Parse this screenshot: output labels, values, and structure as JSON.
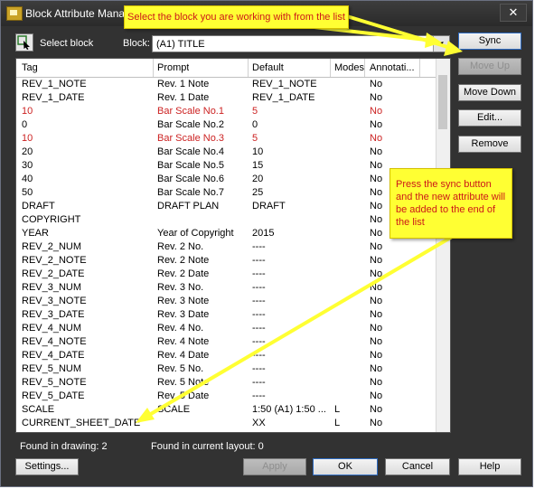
{
  "window": {
    "title": "Block Attribute Manag",
    "close_glyph": "✕"
  },
  "toolbar": {
    "select_block_label": "Select block",
    "block_label": "Block:",
    "block_value": "(A1) TITLE"
  },
  "grid": {
    "headers": [
      "Tag",
      "Prompt",
      "Default",
      "Modes",
      "Annotati..."
    ],
    "rows": [
      {
        "tag": "REV_1_NOTE",
        "prompt": "Rev. 1 Note",
        "default": "REV_1_NOTE",
        "modes": "",
        "annot": "No",
        "red": false
      },
      {
        "tag": "REV_1_DATE",
        "prompt": "Rev. 1 Date",
        "default": "REV_1_DATE",
        "modes": "",
        "annot": "No",
        "red": false
      },
      {
        "tag": "10",
        "prompt": "Bar Scale No.1",
        "default": "5",
        "modes": "",
        "annot": "No",
        "red": true
      },
      {
        "tag": "0",
        "prompt": "Bar Scale No.2",
        "default": "0",
        "modes": "",
        "annot": "No",
        "red": false
      },
      {
        "tag": "10",
        "prompt": "Bar Scale No.3",
        "default": "5",
        "modes": "",
        "annot": "No",
        "red": true
      },
      {
        "tag": "20",
        "prompt": "Bar Scale No.4",
        "default": "10",
        "modes": "",
        "annot": "No",
        "red": false
      },
      {
        "tag": "30",
        "prompt": "Bar Scale No.5",
        "default": "15",
        "modes": "",
        "annot": "No",
        "red": false
      },
      {
        "tag": "40",
        "prompt": "Bar Scale No.6",
        "default": "20",
        "modes": "",
        "annot": "No",
        "red": false
      },
      {
        "tag": "50",
        "prompt": "Bar Scale No.7",
        "default": "25",
        "modes": "",
        "annot": "No",
        "red": false
      },
      {
        "tag": "DRAFT",
        "prompt": "DRAFT PLAN",
        "default": "DRAFT",
        "modes": "",
        "annot": "No",
        "red": false
      },
      {
        "tag": "COPYRIGHT",
        "prompt": "",
        "default": "",
        "modes": "",
        "annot": "No",
        "red": false
      },
      {
        "tag": "YEAR",
        "prompt": "Year of Copyright",
        "default": "2015",
        "modes": "",
        "annot": "No",
        "red": false
      },
      {
        "tag": "REV_2_NUM",
        "prompt": "Rev. 2 No.",
        "default": "----",
        "modes": "",
        "annot": "No",
        "red": false
      },
      {
        "tag": "REV_2_NOTE",
        "prompt": "Rev. 2 Note",
        "default": "----",
        "modes": "",
        "annot": "No",
        "red": false
      },
      {
        "tag": "REV_2_DATE",
        "prompt": "Rev. 2 Date",
        "default": "----",
        "modes": "",
        "annot": "No",
        "red": false
      },
      {
        "tag": "REV_3_NUM",
        "prompt": "Rev. 3 No.",
        "default": "----",
        "modes": "",
        "annot": "No",
        "red": false
      },
      {
        "tag": "REV_3_NOTE",
        "prompt": "Rev. 3 Note",
        "default": "----",
        "modes": "",
        "annot": "No",
        "red": false
      },
      {
        "tag": "REV_3_DATE",
        "prompt": "Rev. 3 Date",
        "default": "----",
        "modes": "",
        "annot": "No",
        "red": false
      },
      {
        "tag": "REV_4_NUM",
        "prompt": "Rev. 4 No.",
        "default": "----",
        "modes": "",
        "annot": "No",
        "red": false
      },
      {
        "tag": "REV_4_NOTE",
        "prompt": "Rev. 4 Note",
        "default": "----",
        "modes": "",
        "annot": "No",
        "red": false
      },
      {
        "tag": "REV_4_DATE",
        "prompt": "Rev. 4 Date",
        "default": "----",
        "modes": "",
        "annot": "No",
        "red": false
      },
      {
        "tag": "REV_5_NUM",
        "prompt": "Rev. 5 No.",
        "default": "----",
        "modes": "",
        "annot": "No",
        "red": false
      },
      {
        "tag": "REV_5_NOTE",
        "prompt": "Rev. 5 Note",
        "default": "----",
        "modes": "",
        "annot": "No",
        "red": false
      },
      {
        "tag": "REV_5_DATE",
        "prompt": "Rev. 5 Date",
        "default": "----",
        "modes": "",
        "annot": "No",
        "red": false
      },
      {
        "tag": "SCALE",
        "prompt": "SCALE",
        "default": "1:50  (A1) 1:50 ...",
        "modes": "L",
        "annot": "No",
        "red": false
      },
      {
        "tag": "CURRENT_SHEET_DATE",
        "prompt": "",
        "default": "XX",
        "modes": "L",
        "annot": "No",
        "red": false
      }
    ]
  },
  "side_buttons": {
    "sync": "Sync",
    "move_up": "Move Up",
    "move_down": "Move Down",
    "edit": "Edit...",
    "remove": "Remove"
  },
  "status": {
    "found_drawing": "Found in drawing: 2",
    "found_layout": "Found in current layout: 0"
  },
  "bottom_buttons": {
    "settings": "Settings...",
    "apply": "Apply",
    "ok": "OK",
    "cancel": "Cancel",
    "help": "Help"
  },
  "callouts": {
    "top": "Select the block you are working with from the list",
    "sync": "Press the sync button and the new attribute will be added to the end of the list"
  },
  "colors": {
    "highlight_text": "#cc2222",
    "callout_fill": "#ffff33",
    "dialog_bg": "#323232"
  }
}
